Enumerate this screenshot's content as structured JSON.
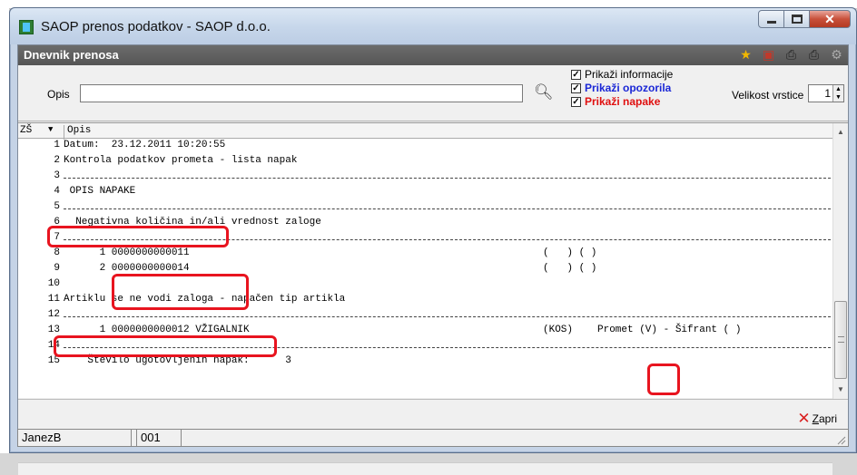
{
  "window": {
    "title": "SAOP prenos podatkov - SAOP d.o.o."
  },
  "panel": {
    "title": "Dnevnik prenosa"
  },
  "filter": {
    "opis_label": "Opis",
    "opis_value": "",
    "checkboxes": [
      {
        "label": "Prikaži informacije",
        "checked": true
      },
      {
        "label": "Prikaži opozorila",
        "checked": true
      },
      {
        "label": "Prikaži napake",
        "checked": true
      }
    ],
    "row_size_label": "Velikost vrstice",
    "row_size_value": "1"
  },
  "grid": {
    "col_zs": "ZŠ",
    "col_sort": "▼",
    "col_opis": "Opis",
    "rows": [
      {
        "num": "1",
        "text": "Datum:  23.12.2011 10:20:55",
        "c1": "",
        "c2": "",
        "sep": false
      },
      {
        "num": "2",
        "text": "Kontrola podatkov prometa - lista napak",
        "c1": "",
        "c2": "",
        "sep": false
      },
      {
        "num": "3",
        "text": "",
        "c1": "",
        "c2": "",
        "sep": true
      },
      {
        "num": "4",
        "text": " OPIS NAPAKE",
        "c1": "",
        "c2": "",
        "sep": false
      },
      {
        "num": "5",
        "text": "",
        "c1": "",
        "c2": "",
        "sep": true
      },
      {
        "num": "6",
        "text": "  Negativna količina in/ali vrednost zaloge",
        "c1": "",
        "c2": "",
        "sep": false
      },
      {
        "num": "7",
        "text": "",
        "c1": "",
        "c2": "",
        "sep": true
      },
      {
        "num": "8",
        "text": "      1 0000000000011",
        "c1": "(   ) ( )",
        "c2": "",
        "sep": false
      },
      {
        "num": "9",
        "text": "      2 0000000000014",
        "c1": "(   ) ( )",
        "c2": "",
        "sep": false
      },
      {
        "num": "10",
        "text": "",
        "c1": "",
        "c2": "",
        "sep": false
      },
      {
        "num": "11",
        "text": "Artiklu se ne vodi zaloga - napačen tip artikla",
        "c1": "",
        "c2": "",
        "sep": false
      },
      {
        "num": "12",
        "text": "",
        "c1": "",
        "c2": "",
        "sep": true
      },
      {
        "num": "13",
        "text": "      1 0000000000012 VŽIGALNIK",
        "c1": "(KOS)",
        "c2": "Promet (V) - Šifrant ( )",
        "sep": false
      },
      {
        "num": "14",
        "text": "",
        "c1": "",
        "c2": "",
        "sep": true
      },
      {
        "num": "15",
        "text": "    Število ugotovljenih napak:      3",
        "c1": "",
        "c2": "",
        "sep": false
      }
    ]
  },
  "footer": {
    "close_label": "Zapri"
  },
  "status": {
    "user": "JanezB",
    "code": "001"
  },
  "icons": [
    "star-icon",
    "export-icon",
    "print-preview-icon",
    "print-icon",
    "tools-icon"
  ],
  "colors": {
    "warn": "#1a27d6",
    "error": "#e01010",
    "highlight": "#e8141f"
  }
}
